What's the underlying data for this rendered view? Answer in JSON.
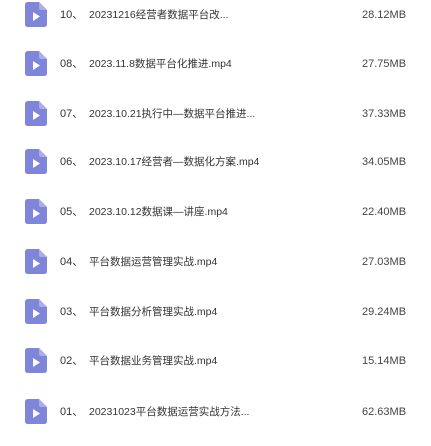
{
  "theme": {
    "icon_color": "#7f86d9",
    "icon_glyph_color": "#ffffff"
  },
  "files": [
    {
      "index": "10、",
      "name": "20231216经营者数据平台改...",
      "size": "28.12MB",
      "icon": "video-file-icon"
    },
    {
      "index": "08、",
      "name": "2023.11.8数据平台化推进.mp4",
      "size": "27.75MB",
      "icon": "video-file-icon"
    },
    {
      "index": "07、",
      "name": "2023.10.21执行中—数据平台推进...",
      "size": "37.33MB",
      "icon": "video-file-icon"
    },
    {
      "index": "06、",
      "name": "2023.10.17经营者—数据化方案.mp4",
      "size": "34.05MB",
      "icon": "video-file-icon"
    },
    {
      "index": "05、",
      "name": "2023.10.12数据课—讲座.mp4",
      "size": "22.40MB",
      "icon": "video-file-icon"
    },
    {
      "index": "04、",
      "name": "平台数据运营管理实战.mp4",
      "size": "27.03MB",
      "icon": "video-file-icon"
    },
    {
      "index": "03、",
      "name": "平台数据分析管理实战.mp4",
      "size": "29.24MB",
      "icon": "video-file-icon"
    },
    {
      "index": "02、",
      "name": "平台数据业务管理实战.mp4",
      "size": "15.14MB",
      "icon": "video-file-icon"
    },
    {
      "index": "01、",
      "name": "20231023平台数据运营实战方法...",
      "size": "62.63MB",
      "icon": "video-file-icon"
    }
  ]
}
